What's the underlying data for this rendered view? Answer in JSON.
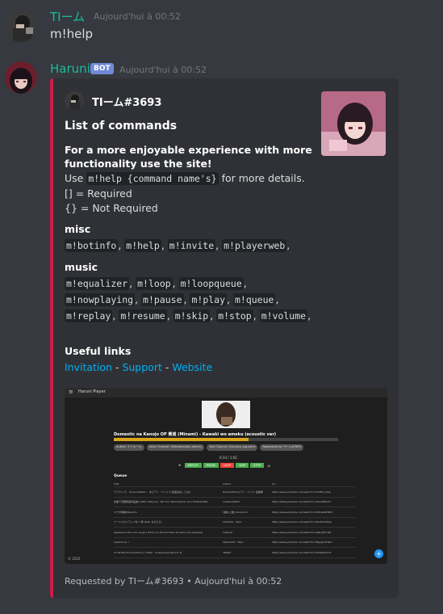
{
  "message1": {
    "username": "TIーム",
    "timestamp": "Aujourd'hui à 00:52",
    "content": "m!help",
    "username_color": "#1abc9c"
  },
  "message2": {
    "username": "Haruni",
    "bot_tag": "BOT",
    "timestamp": "Aujourd'hui à 00:52",
    "username_color": "#1abc9c"
  },
  "embed": {
    "accent_color": "#d01c4a",
    "author": "TIーム#3693",
    "title": "List of commands",
    "description": {
      "bold_line1": "For a more enjoyable experience with more",
      "bold_line2": "functionality use the site!",
      "use_prefix": "Use",
      "use_code": "m!help {command name's}",
      "use_suffix": "for more details.",
      "required": "[] = Required",
      "not_required": "{} = Not Required"
    },
    "fields": {
      "misc": {
        "name": "misc",
        "commands": [
          "m!botinfo",
          "m!help",
          "m!invite",
          "m!playerweb"
        ]
      },
      "music": {
        "name": "music",
        "commands": [
          "m!equalizer",
          "m!loop",
          "m!loopqueue",
          "m!nowplaying",
          "m!pause",
          "m!play",
          "m!queue",
          "m!replay",
          "m!resume",
          "m!skip",
          "m!stop",
          "m!volume"
        ]
      },
      "links": {
        "name": "Useful links",
        "invitation": "Invitation",
        "support": "Support",
        "website": "Website",
        "sep": " - "
      }
    },
    "image": {
      "app_title": "Haruni Player",
      "now_playing": "Domestic na Kanojo OP 黄道 (Minami) - Kawaki wo ameku (acoustic ver)",
      "progress": 0.6,
      "tags": [
        "Author: ナツキーん",
        "Voice Channel: Millenaire(dev-others)",
        "Text Channel: #musico-log-voice",
        "Requested by: TIーム#3693"
      ],
      "time": "0:34 / 1:02",
      "buttons": [
        "REPLAY",
        "PAUSE",
        "LOOP",
        "SKIP",
        "STOP"
      ],
      "queue_title": "Queue",
      "queue_headers": [
        "Title",
        "Author",
        "Url"
      ],
      "queue_rows": [
        [
          "ラブライブ！ Snow halation... をピアノ・バンドで 最強演奏してみた",
          "Bobdusffunkピアノ・バンド 最強隊",
          "https://www.youtube.com/watch?v=VTXP2_aCas"
        ],
        [
          "企業で高難易度作品第2 (Miku Hatsune - Tell Your World (Piano ver.) EVOGLOOM)",
          "nobikevAOISh",
          "https://www.youtube.com/watch?v=1Sox6Bux3Y"
        ],
        [
          "ヤクザ戦線Mitsuhiro",
          "[猫ねこ猫] Cinnamon",
          "https://www.youtube.com/watch?v=KNma4WTRi0"
        ],
        [
          "ベーススタイラップを 1 時 (feat. なるたろ)",
          "Cottolita - Topic",
          "https://www.youtube.com/watch?v=ZLGhfQdQap"
        ],
        [
          "Japanese indie rock songs I think you should listen at least once (playlist)",
          "lowkeyt",
          "https://www.youtube.com/watch?v=vJBndJFYrdI4"
        ],
        [
          "Cyberia Lyr !",
          "Stereoskit - Topic",
          "https://www.youtube.com/watch?v=9Kjpgn47ReU"
        ],
        [
          "12.04 Electronica/Trance / Taafe : Unisphereal [Round 3]",
          "Tefigkt",
          "https://www.youtube.com/watch?v=LfbaRlGe47k"
        ]
      ],
      "copyright": "© 2020"
    },
    "footer": "Requested by TIーム#3693 • Aujourd'hui à 00:52"
  }
}
